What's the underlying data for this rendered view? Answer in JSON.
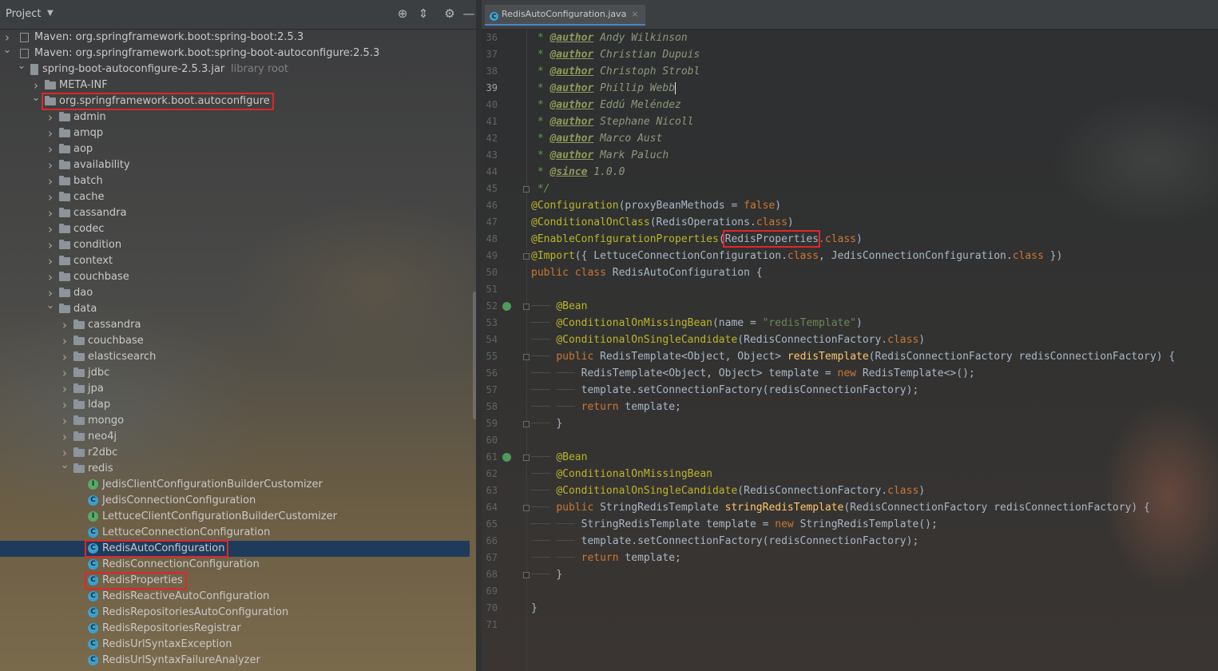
{
  "project_panel": {
    "title": "Project",
    "icons": [
      "locate-icon",
      "collapse-icon",
      "gear-icon",
      "hide-icon"
    ],
    "tree": [
      {
        "label": "Maven: org.springframework.boot:spring-boot:2.5.3",
        "depth": 0,
        "kind": "maven",
        "expanded": false
      },
      {
        "label": "Maven: org.springframework.boot:spring-boot-autoconfigure:2.5.3",
        "depth": 0,
        "kind": "maven",
        "expanded": true
      },
      {
        "label": "spring-boot-autoconfigure-2.5.3.jar",
        "secondary": "library root",
        "depth": 1,
        "kind": "jar",
        "expanded": true
      },
      {
        "label": "META-INF",
        "depth": 2,
        "kind": "folder",
        "expanded": false
      },
      {
        "label": "org.springframework.boot.autoconfigure",
        "depth": 2,
        "kind": "folder",
        "expanded": true,
        "highlighted": true
      },
      {
        "label": "admin",
        "depth": 3,
        "kind": "folder",
        "expanded": false
      },
      {
        "label": "amqp",
        "depth": 3,
        "kind": "folder",
        "expanded": false
      },
      {
        "label": "aop",
        "depth": 3,
        "kind": "folder",
        "expanded": false
      },
      {
        "label": "availability",
        "depth": 3,
        "kind": "folder",
        "expanded": false
      },
      {
        "label": "batch",
        "depth": 3,
        "kind": "folder",
        "expanded": false
      },
      {
        "label": "cache",
        "depth": 3,
        "kind": "folder",
        "expanded": false
      },
      {
        "label": "cassandra",
        "depth": 3,
        "kind": "folder",
        "expanded": false
      },
      {
        "label": "codec",
        "depth": 3,
        "kind": "folder",
        "expanded": false
      },
      {
        "label": "condition",
        "depth": 3,
        "kind": "folder",
        "expanded": false
      },
      {
        "label": "context",
        "depth": 3,
        "kind": "folder",
        "expanded": false
      },
      {
        "label": "couchbase",
        "depth": 3,
        "kind": "folder",
        "expanded": false
      },
      {
        "label": "dao",
        "depth": 3,
        "kind": "folder",
        "expanded": false
      },
      {
        "label": "data",
        "depth": 3,
        "kind": "folder",
        "expanded": true
      },
      {
        "label": "cassandra",
        "depth": 4,
        "kind": "folder",
        "expanded": false
      },
      {
        "label": "couchbase",
        "depth": 4,
        "kind": "folder",
        "expanded": false
      },
      {
        "label": "elasticsearch",
        "depth": 4,
        "kind": "folder",
        "expanded": false
      },
      {
        "label": "jdbc",
        "depth": 4,
        "kind": "folder",
        "expanded": false
      },
      {
        "label": "jpa",
        "depth": 4,
        "kind": "folder",
        "expanded": false
      },
      {
        "label": "ldap",
        "depth": 4,
        "kind": "folder",
        "expanded": false
      },
      {
        "label": "mongo",
        "depth": 4,
        "kind": "folder",
        "expanded": false
      },
      {
        "label": "neo4j",
        "depth": 4,
        "kind": "folder",
        "expanded": false
      },
      {
        "label": "r2dbc",
        "depth": 4,
        "kind": "folder",
        "expanded": false
      },
      {
        "label": "redis",
        "depth": 4,
        "kind": "folder",
        "expanded": true
      },
      {
        "label": "JedisClientConfigurationBuilderCustomizer",
        "depth": 5,
        "kind": "interface"
      },
      {
        "label": "JedisConnectionConfiguration",
        "depth": 5,
        "kind": "class"
      },
      {
        "label": "LettuceClientConfigurationBuilderCustomizer",
        "depth": 5,
        "kind": "interface"
      },
      {
        "label": "LettuceConnectionConfiguration",
        "depth": 5,
        "kind": "class"
      },
      {
        "label": "RedisAutoConfiguration",
        "depth": 5,
        "kind": "class",
        "selected": true,
        "highlighted": true
      },
      {
        "label": "RedisConnectionConfiguration",
        "depth": 5,
        "kind": "class"
      },
      {
        "label": "RedisProperties",
        "depth": 5,
        "kind": "class",
        "highlighted": true
      },
      {
        "label": "RedisReactiveAutoConfiguration",
        "depth": 5,
        "kind": "class"
      },
      {
        "label": "RedisRepositoriesAutoConfiguration",
        "depth": 5,
        "kind": "class"
      },
      {
        "label": "RedisRepositoriesRegistrar",
        "depth": 5,
        "kind": "class"
      },
      {
        "label": "RedisUrlSyntaxException",
        "depth": 5,
        "kind": "class"
      },
      {
        "label": "RedisUrlSyntaxFailureAnalyzer",
        "depth": 5,
        "kind": "class"
      }
    ]
  },
  "editor": {
    "tab_label": "RedisAutoConfiguration.java",
    "tab_close": "×",
    "current_line": 39,
    "highlight_token": "RedisProperties",
    "lines": [
      {
        "n": 36,
        "parts": [
          [
            "cm",
            " * "
          ],
          [
            "tag",
            "@author"
          ],
          [
            "tagval",
            " Andy Wilkinson"
          ]
        ]
      },
      {
        "n": 37,
        "parts": [
          [
            "cm",
            " * "
          ],
          [
            "tag",
            "@author"
          ],
          [
            "tagval",
            " Christian Dupuis"
          ]
        ]
      },
      {
        "n": 38,
        "parts": [
          [
            "cm",
            " * "
          ],
          [
            "tag",
            "@author"
          ],
          [
            "tagval",
            " Christoph Strobl"
          ]
        ]
      },
      {
        "n": 39,
        "parts": [
          [
            "cm",
            " * "
          ],
          [
            "tag",
            "@author"
          ],
          [
            "tagval",
            " Phillip Webb"
          ],
          [
            "caret",
            ""
          ]
        ]
      },
      {
        "n": 40,
        "parts": [
          [
            "cm",
            " * "
          ],
          [
            "tag",
            "@author"
          ],
          [
            "tagval",
            " Eddú Meléndez"
          ]
        ]
      },
      {
        "n": 41,
        "parts": [
          [
            "cm",
            " * "
          ],
          [
            "tag",
            "@author"
          ],
          [
            "tagval",
            " Stephane Nicoll"
          ]
        ]
      },
      {
        "n": 42,
        "parts": [
          [
            "cm",
            " * "
          ],
          [
            "tag",
            "@author"
          ],
          [
            "tagval",
            " Marco Aust"
          ]
        ]
      },
      {
        "n": 43,
        "parts": [
          [
            "cm",
            " * "
          ],
          [
            "tag",
            "@author"
          ],
          [
            "tagval",
            " Mark Paluch"
          ]
        ]
      },
      {
        "n": 44,
        "parts": [
          [
            "cm",
            " * "
          ],
          [
            "tag",
            "@since"
          ],
          [
            "tagval",
            " 1.0.0"
          ]
        ]
      },
      {
        "n": 45,
        "parts": [
          [
            "cm",
            " */"
          ]
        ]
      },
      {
        "n": 46,
        "parts": [
          [
            "ann",
            "@Configuration"
          ],
          [
            "t",
            "(proxyBeanMethods = "
          ],
          [
            "kw",
            "false"
          ],
          [
            "t",
            ")"
          ]
        ]
      },
      {
        "n": 47,
        "parts": [
          [
            "ann",
            "@ConditionalOnClass"
          ],
          [
            "t",
            "(RedisOperations."
          ],
          [
            "kw",
            "class"
          ],
          [
            "t",
            ")"
          ]
        ]
      },
      {
        "n": 48,
        "parts": [
          [
            "ann",
            "@EnableConfigurationProperties"
          ],
          [
            "t",
            "("
          ],
          [
            "hl",
            "RedisProperties"
          ],
          [
            "kw",
            ".class"
          ],
          [
            "t",
            ")"
          ]
        ]
      },
      {
        "n": 49,
        "parts": [
          [
            "ann",
            "@Import"
          ],
          [
            "t",
            "({ LettuceConnectionConfiguration."
          ],
          [
            "kw",
            "class"
          ],
          [
            "t",
            ", JedisConnectionConfiguration."
          ],
          [
            "kw",
            "class"
          ],
          [
            "t",
            " })"
          ]
        ]
      },
      {
        "n": 50,
        "parts": [
          [
            "kw",
            "public class "
          ],
          [
            "t",
            "RedisAutoConfiguration {"
          ]
        ]
      },
      {
        "n": 51,
        "parts": []
      },
      {
        "n": 52,
        "parts": [
          [
            "ind",
            "    "
          ],
          [
            "ann",
            "@Bean"
          ]
        ]
      },
      {
        "n": 53,
        "parts": [
          [
            "ind",
            "    "
          ],
          [
            "ann",
            "@ConditionalOnMissingBean"
          ],
          [
            "t",
            "(name = "
          ],
          [
            "str",
            "\"redisTemplate\""
          ],
          [
            "t",
            ")"
          ]
        ]
      },
      {
        "n": 54,
        "parts": [
          [
            "ind",
            "    "
          ],
          [
            "ann",
            "@ConditionalOnSingleCandidate"
          ],
          [
            "t",
            "(RedisConnectionFactory."
          ],
          [
            "kw",
            "class"
          ],
          [
            "t",
            ")"
          ]
        ]
      },
      {
        "n": 55,
        "parts": [
          [
            "ind",
            "    "
          ],
          [
            "kw",
            "public "
          ],
          [
            "t",
            "RedisTemplate<Object, Object> "
          ],
          [
            "fn",
            "redisTemplate"
          ],
          [
            "t",
            "(RedisConnectionFactory redisConnectionFactory) {"
          ]
        ]
      },
      {
        "n": 56,
        "parts": [
          [
            "ind",
            "        "
          ],
          [
            "t",
            "RedisTemplate<Object, Object> template = "
          ],
          [
            "kw",
            "new "
          ],
          [
            "t",
            "RedisTemplate<>();"
          ]
        ]
      },
      {
        "n": 57,
        "parts": [
          [
            "ind",
            "        "
          ],
          [
            "t",
            "template.setConnectionFactory(redisConnectionFactory);"
          ]
        ]
      },
      {
        "n": 58,
        "parts": [
          [
            "ind",
            "        "
          ],
          [
            "kw",
            "return "
          ],
          [
            "t",
            "template;"
          ]
        ]
      },
      {
        "n": 59,
        "parts": [
          [
            "ind",
            "    "
          ],
          [
            "t",
            "}"
          ]
        ]
      },
      {
        "n": 60,
        "parts": []
      },
      {
        "n": 61,
        "parts": [
          [
            "ind",
            "    "
          ],
          [
            "ann",
            "@Bean"
          ]
        ]
      },
      {
        "n": 62,
        "parts": [
          [
            "ind",
            "    "
          ],
          [
            "ann",
            "@ConditionalOnMissingBean"
          ]
        ]
      },
      {
        "n": 63,
        "parts": [
          [
            "ind",
            "    "
          ],
          [
            "ann",
            "@ConditionalOnSingleCandidate"
          ],
          [
            "t",
            "(RedisConnectionFactory."
          ],
          [
            "kw",
            "class"
          ],
          [
            "t",
            ")"
          ]
        ]
      },
      {
        "n": 64,
        "parts": [
          [
            "ind",
            "    "
          ],
          [
            "kw",
            "public "
          ],
          [
            "t",
            "StringRedisTemplate "
          ],
          [
            "fn",
            "stringRedisTemplate"
          ],
          [
            "t",
            "(RedisConnectionFactory redisConnectionFactory) {"
          ]
        ]
      },
      {
        "n": 65,
        "parts": [
          [
            "ind",
            "        "
          ],
          [
            "t",
            "StringRedisTemplate template = "
          ],
          [
            "kw",
            "new "
          ],
          [
            "t",
            "StringRedisTemplate();"
          ]
        ]
      },
      {
        "n": 66,
        "parts": [
          [
            "ind",
            "        "
          ],
          [
            "t",
            "template.setConnectionFactory(redisConnectionFactory);"
          ]
        ]
      },
      {
        "n": 67,
        "parts": [
          [
            "ind",
            "        "
          ],
          [
            "kw",
            "return "
          ],
          [
            "t",
            "template;"
          ]
        ]
      },
      {
        "n": 68,
        "parts": [
          [
            "ind",
            "    "
          ],
          [
            "t",
            "}"
          ]
        ]
      },
      {
        "n": 69,
        "parts": []
      },
      {
        "n": 70,
        "parts": [
          [
            "t",
            "}"
          ]
        ]
      },
      {
        "n": 71,
        "parts": []
      }
    ],
    "bean_gutter_lines": [
      52,
      61
    ],
    "fold_lines": [
      45,
      49,
      52,
      55,
      59,
      61,
      64,
      68
    ]
  },
  "colors": {
    "selection": "#1f3b5c",
    "highlight_box": "#e0262b",
    "annotation": "#bbb529",
    "keyword": "#cc7832",
    "comment": "#629755"
  }
}
